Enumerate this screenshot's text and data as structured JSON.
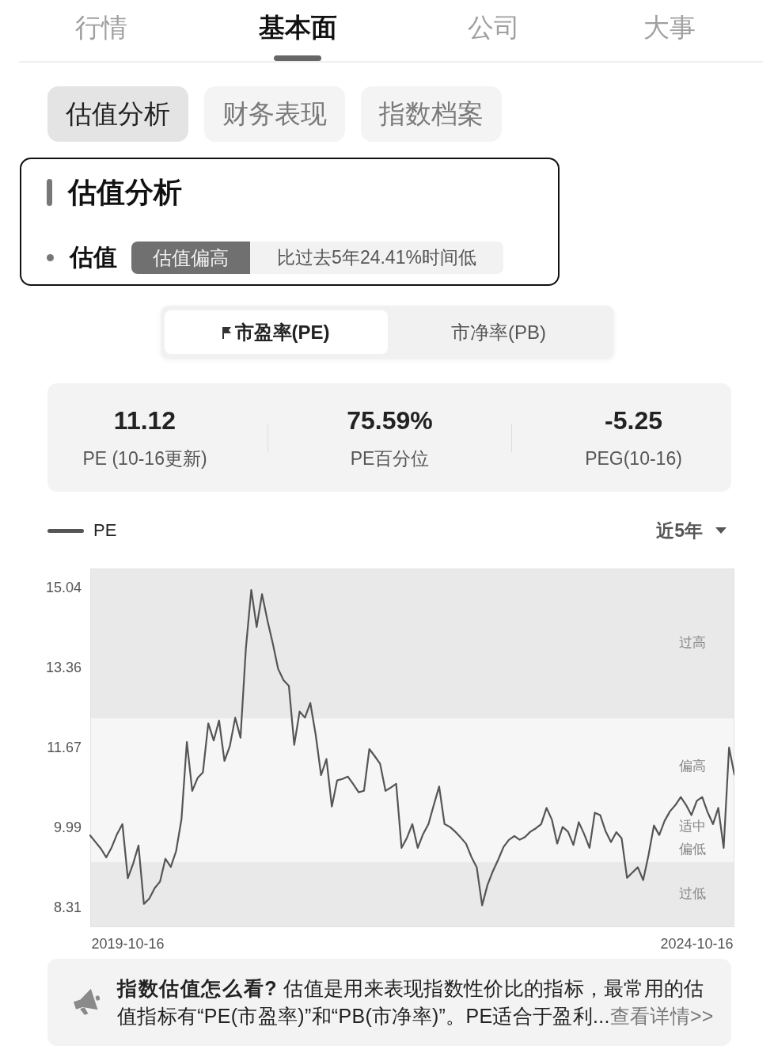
{
  "top_tabs": [
    {
      "label": "行情",
      "selected": false
    },
    {
      "label": "基本面",
      "selected": true
    },
    {
      "label": "公司",
      "selected": false
    },
    {
      "label": "大事",
      "selected": false
    }
  ],
  "sub_tabs": [
    {
      "label": "估值分析",
      "selected": true
    },
    {
      "label": "财务表现",
      "selected": false
    },
    {
      "label": "指数档案",
      "selected": false
    }
  ],
  "valuation_card": {
    "title": "估值分析",
    "row_label": "估值",
    "badge": "估值偏高",
    "comparison": "比过去5年24.41%时间低"
  },
  "metric_toggle": [
    {
      "label": "市盈率(PE)",
      "selected": true
    },
    {
      "label": "市净率(PB)",
      "selected": false
    }
  ],
  "stats": [
    {
      "value": "11.12",
      "label": "PE (10-16更新)"
    },
    {
      "value": "75.59%",
      "label": "PE百分位"
    },
    {
      "value": "-5.25",
      "label": "PEG(10-16)"
    }
  ],
  "chart": {
    "range_select": "近5年",
    "chart_data": {
      "type": "line",
      "categories": [
        null,
        null,
        null,
        null,
        null,
        null,
        null,
        "2019-10-16",
        null,
        null,
        null,
        null,
        null,
        null,
        null,
        null,
        null,
        null,
        null,
        null,
        null,
        null,
        null,
        null,
        null,
        null,
        null,
        null,
        null,
        null,
        null,
        null,
        null,
        null,
        null,
        null,
        null,
        null,
        null,
        null,
        null,
        null,
        null,
        null,
        null,
        null,
        null,
        null,
        null,
        null,
        null,
        null,
        null,
        null,
        null,
        null,
        null,
        null,
        null,
        null,
        null,
        null,
        null,
        null,
        null,
        null,
        null,
        null,
        null,
        null,
        null,
        null,
        null,
        null,
        null,
        null,
        null,
        null,
        null,
        null,
        null,
        null,
        null,
        null,
        null,
        null,
        null,
        null,
        null,
        null,
        null,
        null,
        null,
        null,
        null,
        null,
        null,
        null,
        null,
        null,
        null,
        null,
        null,
        null,
        null,
        null,
        null,
        null,
        null,
        null,
        null,
        null,
        null,
        "2024-10-16",
        null,
        null,
        null,
        null,
        null,
        null,
        null
      ],
      "series": [
        {
          "name": "PE",
          "color": "#555555",
          "values": [
            9.84,
            9.7,
            9.56,
            9.38,
            9.59,
            9.87,
            10.08,
            8.94,
            9.25,
            9.63,
            8.4,
            8.51,
            8.73,
            8.87,
            9.35,
            9.18,
            9.51,
            10.18,
            11.81,
            10.78,
            11.05,
            11.17,
            12.2,
            11.84,
            12.26,
            11.41,
            11.72,
            12.32,
            11.9,
            13.78,
            15.01,
            14.23,
            14.92,
            14.37,
            13.89,
            13.35,
            13.11,
            12.99,
            11.75,
            12.45,
            12.32,
            12.63,
            11.96,
            11.11,
            11.45,
            10.45,
            11.0,
            11.03,
            11.08,
            10.92,
            10.75,
            10.78,
            11.66,
            11.51,
            11.35,
            10.78,
            10.85,
            10.93,
            9.58,
            9.79,
            10.08,
            9.58,
            9.87,
            10.08,
            10.48,
            10.87,
            10.08,
            10.02,
            9.92,
            9.8,
            9.67,
            9.39,
            9.17,
            8.37,
            8.8,
            9.09,
            9.33,
            9.6,
            9.75,
            9.83,
            9.75,
            9.81,
            9.92,
            9.99,
            10.08,
            10.42,
            10.17,
            9.67,
            10.02,
            9.92,
            9.64,
            10.12,
            9.87,
            9.58,
            10.32,
            10.27,
            9.93,
            9.7,
            9.91,
            9.78,
            8.95,
            9.06,
            9.17,
            8.9,
            9.43,
            10.05,
            9.85,
            10.15,
            10.35,
            10.48,
            10.65,
            10.48,
            10.27,
            10.57,
            10.65,
            10.33,
            10.08,
            10.42,
            9.58,
            11.69,
            11.12
          ]
        }
      ],
      "ylim": [
        7.91,
        15.46
      ],
      "yticks": [
        8.31,
        9.99,
        11.67,
        13.36,
        15.04
      ],
      "bands": [
        {
          "axis": "y",
          "label": "过高",
          "from": 12.3,
          "to": 15.46,
          "color": "#e9e9e9"
        },
        {
          "axis": "y",
          "label": "偏高",
          "from": 10.26,
          "to": 12.3,
          "color": "#f6f6f6"
        },
        {
          "axis": "y",
          "label": "适中",
          "from": 9.78,
          "to": 10.26,
          "color": "#f6f6f6"
        },
        {
          "axis": "y",
          "label": "偏低",
          "from": 9.28,
          "to": 9.78,
          "color": "#f6f6f6"
        },
        {
          "axis": "y",
          "label": "过低",
          "from": 7.91,
          "to": 9.28,
          "color": "#e9e9e9"
        }
      ]
    }
  },
  "tip": {
    "text": "**指数估值怎么看?** 估值是用来表现指数性价比的指标，最常用的估值指标有“PE(市盈率)”和“PB(市净率)”。PE适合于盈利...",
    "link": "查看详情>>"
  }
}
